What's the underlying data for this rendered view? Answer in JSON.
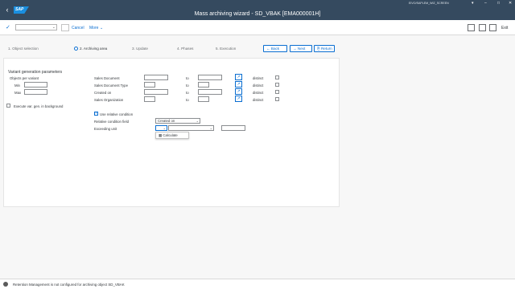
{
  "header": {
    "title": "Mass archiving wizard - SD_VBAK [EMA000001H]",
    "system_label": "EIVO/SAPLEM_WIZ_SCREEN",
    "logo_text": "SAP"
  },
  "toolbar": {
    "cancel_label": "Cancel",
    "more_label": "More",
    "exit_label": "Exit",
    "okcode_value": ""
  },
  "steps": [
    {
      "label": "1. Object selection"
    },
    {
      "label": "2. Archiving area"
    },
    {
      "label": "3. Update"
    },
    {
      "label": "4. Phases"
    },
    {
      "label": "5. Execution"
    }
  ],
  "nav": {
    "back_label": "Back",
    "next_label": "Next",
    "return_label": "Return"
  },
  "left_section": {
    "title": "Variant generation parameters",
    "objects_label": "Objects per variant",
    "min_label": "Min",
    "max_label": "Max",
    "background_label": "Execute var. gen. in background"
  },
  "criteria": {
    "rows": [
      {
        "label": "Sales Document",
        "to": "to",
        "distinct": "distinct"
      },
      {
        "label": "Sales Document Type",
        "to": "to",
        "distinct": "distinct"
      },
      {
        "label": "Created on",
        "to": "to",
        "distinct": "distinct"
      },
      {
        "label": "Sales Organization",
        "to": "to",
        "distinct": "distinct"
      }
    ],
    "use_relative_label": "Use relative condition",
    "relative_field_label": "Relative condition field",
    "relative_field_value": "Created on",
    "exceeding_unit_label": "Exceeding unit",
    "unit_value": "",
    "calculate_label": "Calculate"
  },
  "status": {
    "message": "Retention Management is not configured for archiving object SD_VBAK"
  }
}
